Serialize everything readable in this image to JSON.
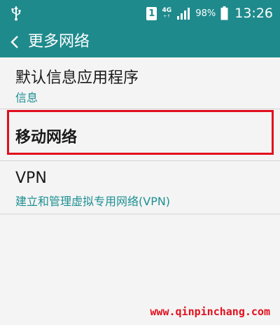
{
  "status_bar": {
    "sim_slot": "1",
    "network_type": "4G",
    "network_sub": "+↑",
    "battery_percent": "98%",
    "time": "13:26",
    "icons": [
      "usb-icon",
      "signal-icon",
      "battery-icon"
    ]
  },
  "action_bar": {
    "title": "更多网络",
    "back_icon": "chevron-left-icon"
  },
  "items": [
    {
      "title": "默认信息应用程序",
      "subtitle": "信息"
    },
    {
      "title": "移动网络"
    },
    {
      "title": "VPN",
      "subtitle": "建立和管理虚拟专用网络(VPN)"
    }
  ],
  "watermark": "www.qinpinchang.com",
  "colors": {
    "header": "#1f8a8c",
    "subtitle": "#1e8f93",
    "highlight": "#e10f1e",
    "background": "#f4f4f4"
  }
}
